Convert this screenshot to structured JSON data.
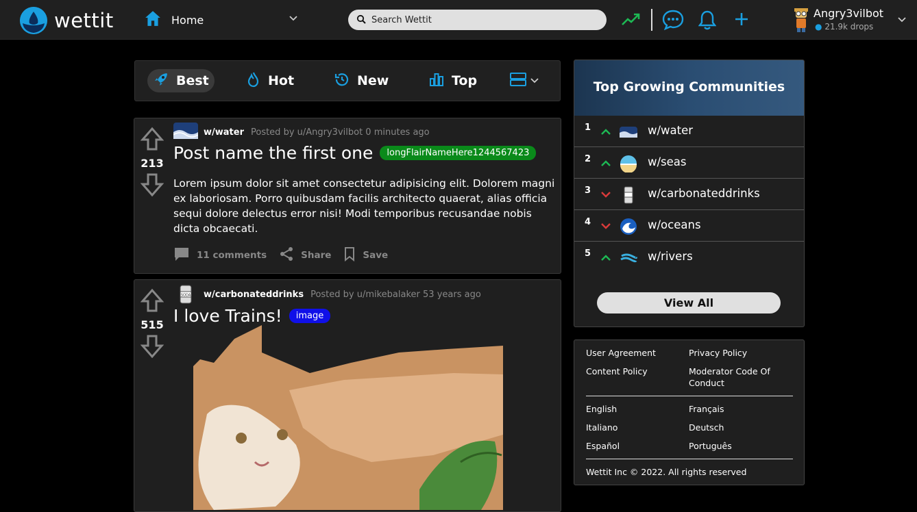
{
  "header": {
    "logo_text": "wettit",
    "home_label": "Home",
    "search_placeholder": "Search Wettit",
    "icons": [
      "trending-icon",
      "chat-icon",
      "bell-icon",
      "plus-icon"
    ],
    "user": {
      "name": "Angry3vilbot",
      "drops": "21.9k drops"
    }
  },
  "sortbar": {
    "items": [
      {
        "label": "Best",
        "icon": "rocket-icon",
        "active": true
      },
      {
        "label": "Hot",
        "icon": "flame-icon",
        "active": false
      },
      {
        "label": "New",
        "icon": "clock-icon",
        "active": false
      },
      {
        "label": "Top",
        "icon": "bar-chart-icon",
        "active": false
      }
    ],
    "view_icon": "card-view-icon"
  },
  "posts": [
    {
      "subreddit": "w/water",
      "posted_by": "Posted by u/Angry3vilbot 0 minutes ago",
      "votes": "213",
      "title": "Post name the first one",
      "flair": "longFlairNameHere1244567423",
      "flair_color": "#0a8a1a",
      "body": "Lorem ipsum dolor sit amet consectetur adipisicing elit. Dolorem magni ex laboriosam. Porro quibusdam facilis architecto quaerat, alias officia sequi dolore delectus error nisi! Modi temporibus recusandae nobis dicta obcaecati.",
      "comments": "11 comments",
      "share": "Share",
      "save": "Save"
    },
    {
      "subreddit": "w/carbonateddrinks",
      "posted_by": "Posted by u/mikebalaker 53 years ago",
      "votes": "515",
      "title": "I love Trains!",
      "flair": "image",
      "flair_color": "#1010e8"
    }
  ],
  "sidebar": {
    "title": "Top Growing Communities",
    "communities": [
      {
        "rank": "1",
        "trend": "up",
        "name": "w/water"
      },
      {
        "rank": "2",
        "trend": "up",
        "name": "w/seas"
      },
      {
        "rank": "3",
        "trend": "down",
        "name": "w/carbonateddrinks"
      },
      {
        "rank": "4",
        "trend": "down",
        "name": "w/oceans"
      },
      {
        "rank": "5",
        "trend": "up",
        "name": "w/rivers"
      }
    ],
    "view_all": "View All"
  },
  "footer": {
    "links": [
      "User Agreement",
      "Privacy Policy",
      "Content Policy",
      "Moderator Code Of Conduct"
    ],
    "languages": [
      "English",
      "Français",
      "Italiano",
      "Deutsch",
      "Español",
      "Português"
    ],
    "copyright": "Wettit Inc © 2022. All rights reserved"
  },
  "colors": {
    "accent": "#1a9fe0",
    "up": "#1db954",
    "down": "#d93a3a"
  }
}
